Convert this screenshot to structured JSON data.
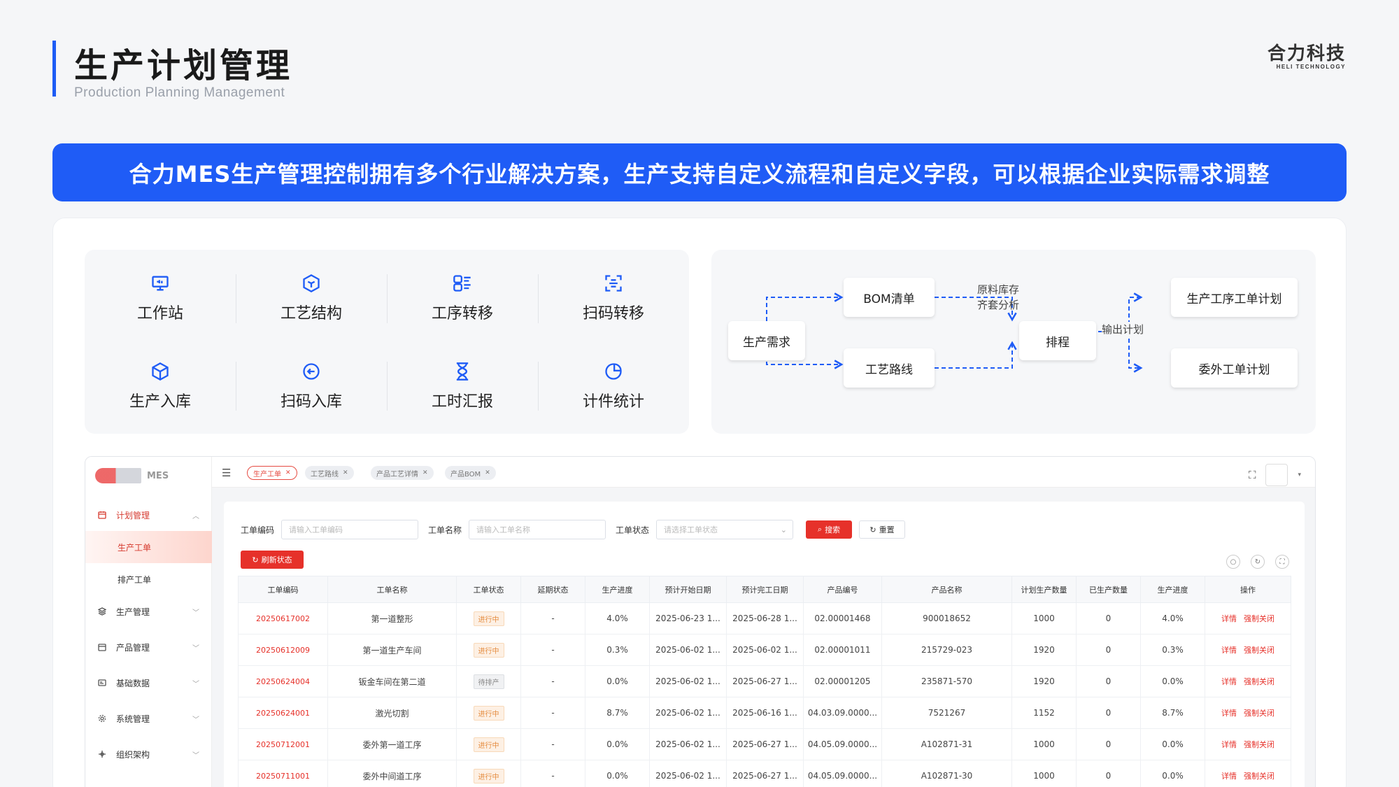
{
  "header": {
    "title": "生产计划管理",
    "subtitle": "Production Planning Management",
    "logo_cn": "合力科技",
    "logo_en": "HELI TECHNOLOGY"
  },
  "banner": {
    "text": "合力MES生产管理控制拥有多个行业解决方案，生产支持自定义流程和自定义字段，可以根据企业实际需求调整"
  },
  "features": [
    {
      "label": "工作站",
      "icon": "monitor-icon"
    },
    {
      "label": "工艺结构",
      "icon": "cube-hex-icon"
    },
    {
      "label": "工序转移",
      "icon": "transfer-list-icon"
    },
    {
      "label": "扫码转移",
      "icon": "scan-icon"
    },
    {
      "label": "生产入库",
      "icon": "box-icon"
    },
    {
      "label": "扫码入库",
      "icon": "scan-in-icon"
    },
    {
      "label": "工时汇报",
      "icon": "hourglass-icon"
    },
    {
      "label": "计件统计",
      "icon": "pie-chart-icon"
    }
  ],
  "flow": {
    "demand": "生产需求",
    "bom": "BOM清单",
    "route": "工艺路线",
    "schedule": "排程",
    "note_stock_1": "原料库存",
    "note_stock_2": "齐套分析",
    "note_output": "输出计划",
    "plan_process": "生产工序工单计划",
    "plan_outsource": "委外工单计划"
  },
  "app": {
    "brand": "MES",
    "sidebar": {
      "plan": "计划管理",
      "sub_order": "生产工单",
      "sub_schedule": "排产工单",
      "production": "生产管理",
      "product": "产品管理",
      "basic": "基础数据",
      "system": "系统管理",
      "org": "组织架构"
    },
    "tabs": [
      "生产工单",
      "工艺路线",
      "产品工艺详情",
      "产品BOM"
    ],
    "filters": {
      "code_label": "工单编码",
      "code_placeholder": "请输入工单编码",
      "name_label": "工单名称",
      "name_placeholder": "请输入工单名称",
      "status_label": "工单状态",
      "status_placeholder": "请选择工单状态",
      "search": "搜索",
      "reset": "重置",
      "refresh": "刷新状态"
    },
    "columns": [
      "工单编码",
      "工单名称",
      "工单状态",
      "延期状态",
      "生产进度",
      "预计开始日期",
      "预计完工日期",
      "产品编号",
      "产品名称",
      "计划生产数量",
      "已生产数量",
      "生产进度",
      "操作"
    ],
    "op_detail": "详情",
    "op_close": "强制关闭",
    "rows": [
      [
        "20250617002",
        "第一道整形",
        "进行中",
        "-",
        "4.0%",
        "2025-06-23 1...",
        "2025-06-28 1...",
        "02.00001468",
        "900018652",
        "1000",
        "0",
        "4.0%"
      ],
      [
        "20250612009",
        "第一道生产车间",
        "进行中",
        "-",
        "0.3%",
        "2025-06-02 1...",
        "2025-06-02 1...",
        "02.00001011",
        "215729-023",
        "1920",
        "0",
        "0.3%"
      ],
      [
        "20250624004",
        "钣金车间在第二道",
        "待排产",
        "-",
        "0.0%",
        "2025-06-02 1...",
        "2025-06-27 1...",
        "02.00001205",
        "235871-570",
        "1920",
        "0",
        "0.0%"
      ],
      [
        "20250624001",
        "激光切割",
        "进行中",
        "-",
        "8.7%",
        "2025-06-02 1...",
        "2025-06-16 1...",
        "04.03.09.0000...",
        "7521267",
        "1152",
        "0",
        "8.7%"
      ],
      [
        "20250712001",
        "委外第一道工序",
        "进行中",
        "-",
        "0.0%",
        "2025-06-02 1...",
        "2025-06-27 1...",
        "04.05.09.0000...",
        "A102871-31",
        "1000",
        "0",
        "0.0%"
      ],
      [
        "20250711001",
        "委外中间道工序",
        "进行中",
        "-",
        "0.0%",
        "2025-06-02 1...",
        "2025-06-27 1...",
        "04.05.09.0000...",
        "A102871-30",
        "1000",
        "0",
        "0.0%"
      ]
    ]
  },
  "colors": {
    "accent": "#1f5cf6",
    "app_red": "#e6312a"
  }
}
